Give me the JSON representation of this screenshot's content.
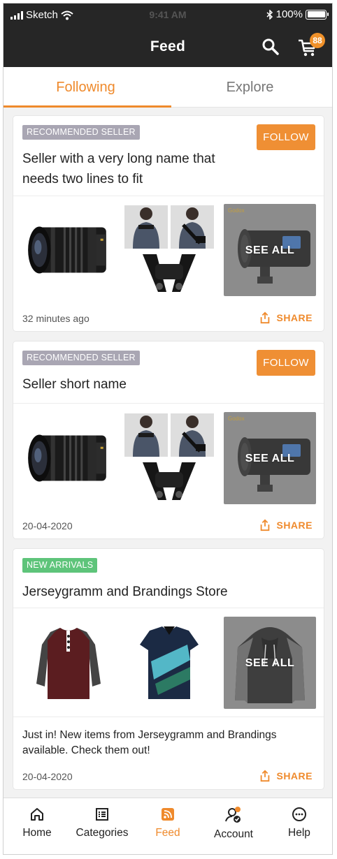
{
  "status_bar": {
    "carrier": "Sketch",
    "time": "9:41 AM",
    "battery": "100%"
  },
  "nav": {
    "title": "Feed",
    "cart_count": "88"
  },
  "tabs": [
    {
      "label": "Following"
    },
    {
      "label": "Explore"
    }
  ],
  "cards": [
    {
      "badge": "RECOMMENDED SELLER",
      "follow_label": "FOLLOW",
      "seller_name": "Seller with a very long name that needs two lines to fit",
      "see_all": "SEE ALL",
      "timestamp": "32 minutes ago",
      "share_label": "SHARE"
    },
    {
      "badge": "RECOMMENDED SELLER",
      "follow_label": "FOLLOW",
      "seller_name": "Seller short name",
      "see_all": "SEE ALL",
      "timestamp": "20-04-2020",
      "share_label": "SHARE"
    },
    {
      "badge": "NEW ARRIVALS",
      "seller_name": "Jerseygramm and Brandings Store",
      "see_all": "SEE ALL",
      "description": "Just in! New items from Jerseygramm and Brandings available. Check them out!",
      "timestamp": "20-04-2020",
      "share_label": "SHARE"
    }
  ],
  "tab_bar": [
    {
      "label": "Home",
      "icon": "home-icon"
    },
    {
      "label": "Categories",
      "icon": "list-icon"
    },
    {
      "label": "Feed",
      "icon": "rss-icon"
    },
    {
      "label": "Account",
      "icon": "account-icon"
    },
    {
      "label": "Help",
      "icon": "help-icon"
    }
  ],
  "colors": {
    "accent": "#ef8a2c",
    "nav_background": "#262626",
    "recommended_badge": "#a9a6b3",
    "new_arrivals_badge": "#5ec47a"
  }
}
